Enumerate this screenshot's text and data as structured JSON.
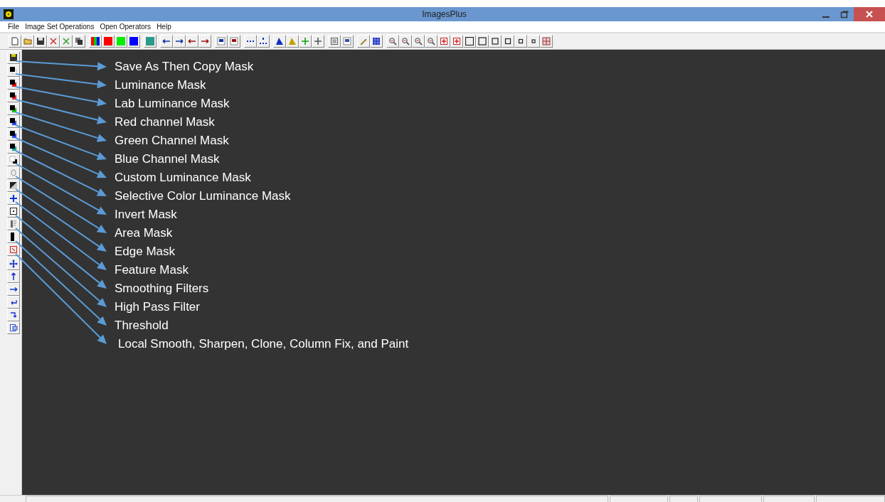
{
  "window": {
    "title": "ImagesPlus"
  },
  "menu": [
    "File",
    "Image Set Operations",
    "Open Operators",
    "Help"
  ],
  "annotations": [
    {
      "label": "Save As Then Copy Mask"
    },
    {
      "label": "Luminance Mask"
    },
    {
      "label": "Lab Luminance Mask"
    },
    {
      "label": "Red channel Mask"
    },
    {
      "label": "Green Channel Mask"
    },
    {
      "label": "Blue Channel Mask"
    },
    {
      "label": "Custom Luminance Mask"
    },
    {
      "label": "Selective Color Luminance Mask"
    },
    {
      "label": "Invert Mask"
    },
    {
      "label": "Area Mask"
    },
    {
      "label": "Edge Mask"
    },
    {
      "label": "Feature Mask"
    },
    {
      "label": "Smoothing Filters"
    },
    {
      "label": "High Pass Filter"
    },
    {
      "label": "Threshold"
    },
    {
      "label": "Local Smooth, Sharpen, Clone, Column Fix, and Paint"
    }
  ]
}
